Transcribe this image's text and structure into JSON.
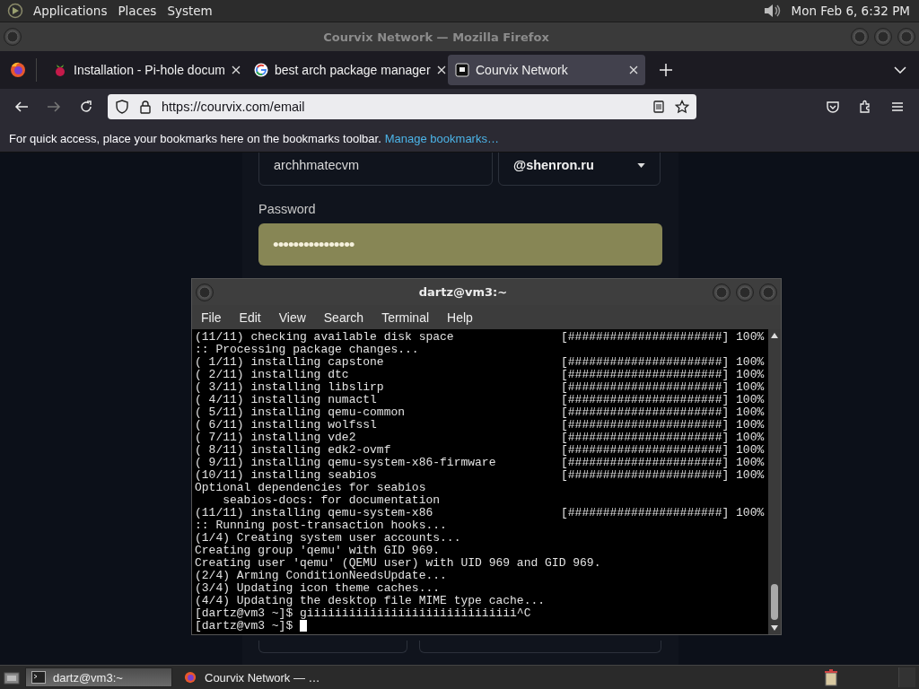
{
  "top_panel": {
    "menus": [
      "Applications",
      "Places",
      "System"
    ],
    "clock": "Mon Feb 6, 6:32 PM"
  },
  "browser": {
    "title": "Courvix Network — Mozilla Firefox",
    "tabs": [
      {
        "label": "Installation - Pi-hole docum",
        "kind": "raspberry",
        "selected": false
      },
      {
        "label": "best arch package manager",
        "kind": "google",
        "selected": false
      },
      {
        "label": "Courvix Network",
        "kind": "square",
        "selected": true
      }
    ],
    "url": "https://courvix.com/email",
    "bookmarks_hint": "For quick access, place your bookmarks here on the bookmarks toolbar.",
    "bookmarks_link": "Manage bookmarks…"
  },
  "form": {
    "username": "archhmatecvm",
    "domain": "@shenron.ru",
    "password_label": "Password",
    "password": "••••••••••••••••"
  },
  "terminal": {
    "title": "dartz@vm3:~",
    "menu": [
      "File",
      "Edit",
      "View",
      "Search",
      "Terminal",
      "Help"
    ],
    "lines": [
      {
        "text": "(11/11) checking available disk space",
        "bar": "[######################]",
        "percent": "100%"
      },
      {
        "text": ":: Processing package changes..."
      },
      {
        "text": "( 1/11) installing capstone",
        "bar": "[######################]",
        "percent": "100%"
      },
      {
        "text": "( 2/11) installing dtc",
        "bar": "[######################]",
        "percent": "100%"
      },
      {
        "text": "( 3/11) installing libslirp",
        "bar": "[######################]",
        "percent": "100%"
      },
      {
        "text": "( 4/11) installing numactl",
        "bar": "[######################]",
        "percent": "100%"
      },
      {
        "text": "( 5/11) installing qemu-common",
        "bar": "[######################]",
        "percent": "100%"
      },
      {
        "text": "( 6/11) installing wolfssl",
        "bar": "[######################]",
        "percent": "100%"
      },
      {
        "text": "( 7/11) installing vde2",
        "bar": "[######################]",
        "percent": "100%"
      },
      {
        "text": "( 8/11) installing edk2-ovmf",
        "bar": "[######################]",
        "percent": "100%"
      },
      {
        "text": "( 9/11) installing qemu-system-x86-firmware",
        "bar": "[######################]",
        "percent": "100%"
      },
      {
        "text": "(10/11) installing seabios",
        "bar": "[######################]",
        "percent": "100%"
      },
      {
        "text": "Optional dependencies for seabios"
      },
      {
        "text": "    seabios-docs: for documentation"
      },
      {
        "text": "(11/11) installing qemu-system-x86",
        "bar": "[######################]",
        "percent": "100%"
      },
      {
        "text": ":: Running post-transaction hooks..."
      },
      {
        "text": "(1/4) Creating system user accounts..."
      },
      {
        "text": "Creating group 'qemu' with GID 969."
      },
      {
        "text": "Creating user 'qemu' (QEMU user) with UID 969 and GID 969."
      },
      {
        "text": "(2/4) Arming ConditionNeedsUpdate..."
      },
      {
        "text": "(3/4) Updating icon theme caches..."
      },
      {
        "text": "(4/4) Updating the desktop file MIME type cache..."
      },
      {
        "text": "[dartz@vm3 ~]$ giiiiiiiiiiiiiiiiiiiiiiiiiiiiii^C"
      },
      {
        "text": "[dartz@vm3 ~]$ ",
        "cursor": true
      }
    ]
  },
  "taskbar": {
    "tasks": [
      {
        "label": "dartz@vm3:~",
        "kind": "terminal",
        "selected": true
      },
      {
        "label": "Courvix Network — …",
        "kind": "browser",
        "selected": false
      }
    ]
  }
}
